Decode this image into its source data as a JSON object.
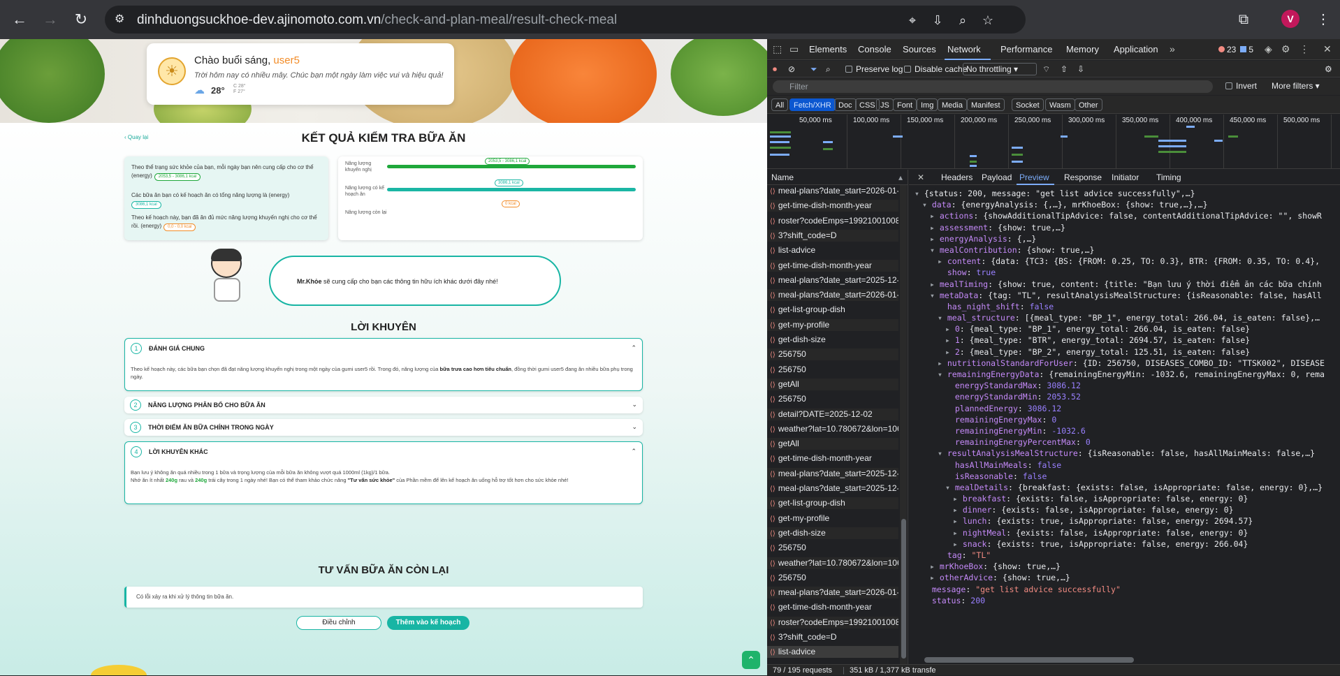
{
  "browser": {
    "url_host": "dinhduongsuckhoe-dev.ajinomoto.com.vn",
    "url_path": "/check-and-plan-meal/result-check-meal",
    "avatar_letter": "V"
  },
  "greeting": {
    "hello": "Chào buổi sáng, ",
    "user": "user5",
    "subtitle": "Trời hôm nay có nhiều mây. Chúc bạn một ngày làm việc vui và hiệu quả!",
    "temp": "28°",
    "tmin": "C 28°",
    "tmax": "F 27°"
  },
  "page": {
    "back": "Quay lại",
    "title": "KẾT QUẢ KIỂM TRA BỮA ĂN",
    "summary": [
      {
        "text": "Theo thể trạng sức khỏe của bạn, mỗi ngày bạn nên cung cấp cho cơ thể (energy)",
        "badge": "2053,5 - 3086,1 kcal"
      },
      {
        "text": "Các bữa ăn bạn có kế hoạch ăn có tổng năng lượng là (energy)",
        "badge": "3086,1 kcal"
      },
      {
        "text": "Theo kế hoạch này, bạn đã ăn đủ mức năng lượng khuyến nghị cho cơ thể rồi. (energy)",
        "badge": "0,0 - 0,0 kcal"
      }
    ],
    "bars": [
      {
        "label": "Năng lượng khuyến nghị",
        "badge": "2053,5 - 3086,1 kcal"
      },
      {
        "label": "Năng lượng có kế hoạch ăn",
        "badge": "3086,1 kcal"
      },
      {
        "label": "Năng lượng còn lại",
        "badge": "0 kcal"
      }
    ],
    "mrkhoe_name": "Mr.Khỏe",
    "mrkhoe_text": " sẽ cung cấp cho bạn các thông tin hữu ích khác dưới đây nhé!",
    "advice_title": "LỜI KHUYÊN",
    "sections": [
      {
        "num": "1",
        "title": "ĐÁNH GIÁ CHUNG",
        "chev": "⌃"
      },
      {
        "num": "2",
        "title": "NĂNG LƯỢNG PHÂN BỔ CHO BỮA ĂN",
        "chev": "⌄"
      },
      {
        "num": "3",
        "title": "THỜI ĐIỂM ĂN BỮA CHÍNH TRONG NGÀY",
        "chev": "⌄"
      },
      {
        "num": "4",
        "title": "LỜI KHUYÊN KHÁC",
        "chev": "⌃"
      }
    ],
    "s1_a": "Theo kế hoạch này, các bữa bạn chọn đã đạt năng lượng khuyến nghị trong một ngày của gumi user5 rồi. Trong đó, năng lượng của ",
    "s1_b": "bữa trưa cao hơn tiêu chuẩn",
    "s1_c": ", đồng thời gumi user5 đang ăn nhiều bữa phụ trong ngày.",
    "s4_l1": "Bạn lưu ý không ăn quá nhiều trong 1 bữa và trọng lượng của mỗi bữa ăn không vượt quá 1000ml (1kg)/1 bữa.",
    "s4_a": "Nhớ ăn ít nhất ",
    "s4_b": "240g",
    "s4_c": " rau và ",
    "s4_d": "240g",
    "s4_e": " trái cây trong 1 ngày nhé! Bạn có thể tham khảo chức năng ",
    "s4_f": "\"Tư vấn sức khỏe\"",
    "s4_g": " của Phần mềm để lên kế hoạch ăn uống hỗ trợ tốt hơn cho sức khỏe nhé!",
    "remaining_title": "TƯ VẤN BỮA ĂN CÒN LẠI",
    "error_text": "Có lỗi xảy ra khi xử lý thông tin bữa ăn.",
    "btn_adjust": "Điều chỉnh",
    "btn_add": "Thêm vào kế hoạch"
  },
  "devtools": {
    "tabs": [
      "Elements",
      "Console",
      "Sources",
      "Network",
      "Performance",
      "Memory",
      "Application"
    ],
    "errors": "23",
    "messages": "5",
    "preserve_log": "Preserve log",
    "disable_cache": "Disable cache",
    "throttling": "No throttling",
    "filter": "Filter",
    "invert": "Invert",
    "more_filters": "More filters",
    "chips": [
      "All",
      "Fetch/XHR",
      "Doc",
      "CSS",
      "JS",
      "Font",
      "Img",
      "Media",
      "Manifest",
      "Socket",
      "Wasm",
      "Other"
    ],
    "timeline": [
      "50,000 ms",
      "100,000 ms",
      "150,000 ms",
      "200,000 ms",
      "250,000 ms",
      "300,000 ms",
      "350,000 ms",
      "400,000 ms",
      "450,000 ms",
      "500,000 ms"
    ],
    "name_header": "Name",
    "requests": [
      "meal-plans?date_start=2026-01-01&...",
      "get-time-dish-month-year",
      "roster?codeEmps=19921001008&dat...",
      "3?shift_code=D",
      "list-advice",
      "get-time-dish-month-year",
      "meal-plans?date_start=2025-12-01&...",
      "meal-plans?date_start=2026-01-01&...",
      "get-list-group-dish",
      "get-my-profile",
      "get-dish-size",
      "256750",
      "256750",
      "getAll",
      "256750",
      "detail?DATE=2025-12-02",
      "weather?lat=10.780672&lon=106.64...",
      "getAll",
      "get-time-dish-month-year",
      "meal-plans?date_start=2025-12-01&...",
      "meal-plans?date_start=2025-12-01&...",
      "get-list-group-dish",
      "get-my-profile",
      "get-dish-size",
      "256750",
      "weather?lat=10.780672&lon=106.64...",
      "256750",
      "meal-plans?date_start=2026-01-01&...",
      "get-time-dish-month-year",
      "roster?codeEmps=19921001008&dat...",
      "3?shift_code=D",
      "list-advice"
    ],
    "detail_tabs": [
      "Headers",
      "Payload",
      "Preview",
      "Response",
      "Initiator",
      "Timing"
    ],
    "status_requests": "79 / 195 requests",
    "status_size": "351 kB / 1,377 kB transfe",
    "json": [
      {
        "i": 0,
        "t": "▾",
        "k": "",
        "v": "{status: 200, message: \"get list advice successfully\",…}",
        "kc": "",
        "vc": ""
      },
      {
        "i": 1,
        "t": "▾",
        "k": "data",
        "v": "{energyAnalysis: {,…}, mrKhoeBox: {show: true,…},…}",
        "kc": "kp",
        "vc": ""
      },
      {
        "i": 2,
        "t": "▸",
        "k": "actions",
        "v": "{showAdditionalTipAdvice: false, contentAdditionalTipAdvice: \"\", showR",
        "kc": "kp",
        "vc": ""
      },
      {
        "i": 2,
        "t": "▸",
        "k": "assessment",
        "v": "{show: true,…}",
        "kc": "kp",
        "vc": ""
      },
      {
        "i": 2,
        "t": "▸",
        "k": "energyAnalysis",
        "v": "{,…}",
        "kc": "kp",
        "vc": ""
      },
      {
        "i": 2,
        "t": "▾",
        "k": "mealContribution",
        "v": "{show: true,…}",
        "kc": "kp",
        "vc": ""
      },
      {
        "i": 3,
        "t": "▸",
        "k": "content",
        "v": "{data: {TC3: {BS: {FROM: 0.25, TO: 0.3}, BTR: {FROM: 0.35, TO: 0.4},",
        "kc": "kp",
        "vc": ""
      },
      {
        "i": 3,
        "t": " ",
        "k": "show",
        "v": "true",
        "kc": "kp",
        "vc": "bl"
      },
      {
        "i": 2,
        "t": "▸",
        "k": "mealTiming",
        "v": "{show: true, content: {title: \"Bạn lưu ý thời điểm ăn các bữa chính",
        "kc": "kp",
        "vc": ""
      },
      {
        "i": 2,
        "t": "▾",
        "k": "metaData",
        "v": "{tag: \"TL\", resultAnalysisMealStructure: {isReasonable: false, hasAll",
        "kc": "kp",
        "vc": ""
      },
      {
        "i": 3,
        "t": " ",
        "k": "has_night_shift",
        "v": "false",
        "kc": "kp",
        "vc": "bl"
      },
      {
        "i": 3,
        "t": "▾",
        "k": "meal_structure",
        "v": "[{meal_type: \"BP_1\", energy_total: 266.04, is_eaten: false},…",
        "kc": "kp",
        "vc": ""
      },
      {
        "i": 4,
        "t": "▸",
        "k": "0",
        "v": "{meal_type: \"BP_1\", energy_total: 266.04, is_eaten: false}",
        "kc": "kp",
        "vc": ""
      },
      {
        "i": 4,
        "t": "▸",
        "k": "1",
        "v": "{meal_type: \"BTR\", energy_total: 2694.57, is_eaten: false}",
        "kc": "kp",
        "vc": ""
      },
      {
        "i": 4,
        "t": "▸",
        "k": "2",
        "v": "{meal_type: \"BP_2\", energy_total: 125.51, is_eaten: false}",
        "kc": "kp",
        "vc": ""
      },
      {
        "i": 3,
        "t": "▸",
        "k": "nutritionalStandardForUser",
        "v": "{ID: 256750, DISEASES_COMBO_ID: \"TTSK002\", DISEASE",
        "kc": "kp",
        "vc": ""
      },
      {
        "i": 3,
        "t": "▾",
        "k": "remainingEnergyData",
        "v": "{remainingEnergyMin: -1032.6, remainingEnergyMax: 0, rema",
        "kc": "kp",
        "vc": ""
      },
      {
        "i": 4,
        "t": " ",
        "k": "energyStandardMax",
        "v": "3086.12",
        "kc": "kp",
        "vc": "n"
      },
      {
        "i": 4,
        "t": " ",
        "k": "energyStandardMin",
        "v": "2053.52",
        "kc": "kp",
        "vc": "n"
      },
      {
        "i": 4,
        "t": " ",
        "k": "plannedEnergy",
        "v": "3086.12",
        "kc": "kp",
        "vc": "n"
      },
      {
        "i": 4,
        "t": " ",
        "k": "remainingEnergyMax",
        "v": "0",
        "kc": "kp",
        "vc": "n"
      },
      {
        "i": 4,
        "t": " ",
        "k": "remainingEnergyMin",
        "v": "-1032.6",
        "kc": "kp",
        "vc": "n"
      },
      {
        "i": 4,
        "t": " ",
        "k": "remainingEnergyPercentMax",
        "v": "0",
        "kc": "kp",
        "vc": "n"
      },
      {
        "i": 3,
        "t": "▾",
        "k": "resultAnalysisMealStructure",
        "v": "{isReasonable: false, hasAllMainMeals: false,…}",
        "kc": "kp",
        "vc": ""
      },
      {
        "i": 4,
        "t": " ",
        "k": "hasAllMainMeals",
        "v": "false",
        "kc": "kp",
        "vc": "bl"
      },
      {
        "i": 4,
        "t": " ",
        "k": "isReasonable",
        "v": "false",
        "kc": "kp",
        "vc": "bl"
      },
      {
        "i": 4,
        "t": "▾",
        "k": "mealDetails",
        "v": "{breakfast: {exists: false, isAppropriate: false, energy: 0},…}",
        "kc": "kp",
        "vc": ""
      },
      {
        "i": 5,
        "t": "▸",
        "k": "breakfast",
        "v": "{exists: false, isAppropriate: false, energy: 0}",
        "kc": "kp",
        "vc": ""
      },
      {
        "i": 5,
        "t": "▸",
        "k": "dinner",
        "v": "{exists: false, isAppropriate: false, energy: 0}",
        "kc": "kp",
        "vc": ""
      },
      {
        "i": 5,
        "t": "▸",
        "k": "lunch",
        "v": "{exists: true, isAppropriate: false, energy: 2694.57}",
        "kc": "kp",
        "vc": ""
      },
      {
        "i": 5,
        "t": "▸",
        "k": "nightMeal",
        "v": "{exists: false, isAppropriate: false, energy: 0}",
        "kc": "kp",
        "vc": ""
      },
      {
        "i": 5,
        "t": "▸",
        "k": "snack",
        "v": "{exists: true, isAppropriate: false, energy: 266.04}",
        "kc": "kp",
        "vc": ""
      },
      {
        "i": 3,
        "t": " ",
        "k": "tag",
        "v": "\"TL\"",
        "kc": "kp",
        "vc": "s"
      },
      {
        "i": 2,
        "t": "▸",
        "k": "mrKhoeBox",
        "v": "{show: true,…}",
        "kc": "kp",
        "vc": ""
      },
      {
        "i": 2,
        "t": "▸",
        "k": "otherAdvice",
        "v": "{show: true,…}",
        "kc": "kp",
        "vc": ""
      },
      {
        "i": 1,
        "t": " ",
        "k": "message",
        "v": "\"get list advice successfully\"",
        "kc": "kp",
        "vc": "s"
      },
      {
        "i": 1,
        "t": " ",
        "k": "status",
        "v": "200",
        "kc": "kp",
        "vc": "n"
      }
    ]
  }
}
